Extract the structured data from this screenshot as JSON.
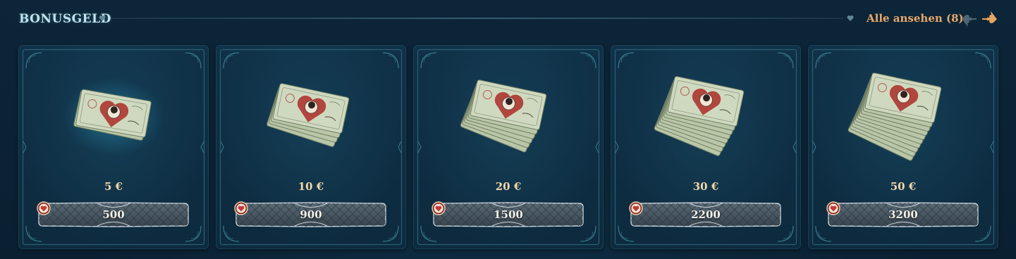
{
  "header": {
    "title": "BONUSGELD",
    "view_all_label": "Alle ansehen (8)"
  },
  "colors": {
    "background": "#0b2236",
    "title": "#bfe3ea",
    "accent": "#e8a86a",
    "amount": "#f1d7a9",
    "coin": "#c23a3a"
  },
  "icons": {
    "header_divider": "heart-icon",
    "prev": "spade-arrow-left-icon",
    "next": "spade-arrow-right-icon",
    "currency": "heart-coin-icon"
  },
  "offers": [
    {
      "amount": "5 €",
      "price": "500",
      "bills": 2
    },
    {
      "amount": "10 €",
      "price": "900",
      "bills": 4
    },
    {
      "amount": "20 €",
      "price": "1500",
      "bills": 6
    },
    {
      "amount": "30 €",
      "price": "2200",
      "bills": 8
    },
    {
      "amount": "50 €",
      "price": "3200",
      "bills": 10
    }
  ]
}
